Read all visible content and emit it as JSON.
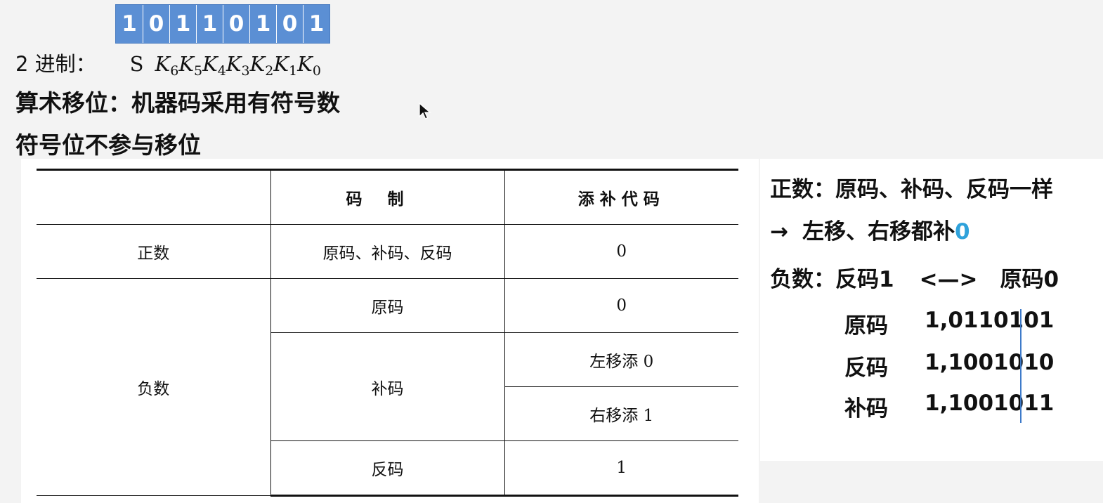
{
  "bits": [
    "1",
    "0",
    "1",
    "1",
    "0",
    "1",
    "0",
    "1"
  ],
  "base_line": {
    "label": "2 进制：",
    "sign": "S",
    "vars": [
      {
        "k": "K",
        "i": "6"
      },
      {
        "k": "K",
        "i": "5"
      },
      {
        "k": "K",
        "i": "4"
      },
      {
        "k": "K",
        "i": "3"
      },
      {
        "k": "K",
        "i": "2"
      },
      {
        "k": "K",
        "i": "1"
      },
      {
        "k": "K",
        "i": "0"
      }
    ]
  },
  "headings": {
    "h1": "算术移位：机器码采用有符号数",
    "h2": "符号位不参与移位"
  },
  "table": {
    "header": {
      "blank": "",
      "col1": "码制",
      "col2": "添补代码"
    },
    "positive": {
      "label": "正数",
      "code": "原码、补码、反码",
      "fill": "0"
    },
    "negative": {
      "label": "负数",
      "yuan": {
        "code": "原码",
        "fill": "0"
      },
      "bu": {
        "code": "补码",
        "fill_left": "左移添 0",
        "fill_right": "右移添 1"
      },
      "fan": {
        "code": "反码",
        "fill": "1"
      }
    }
  },
  "notes": {
    "line1": "正数：原码、补码、反码一样",
    "line2_arrow": "→",
    "line2_text": "左移、右移都补",
    "line2_value": "0",
    "line3_label": "负数：反码1",
    "line3_arrow": "<—>",
    "line3_tail": "原码0",
    "accent_color": "#2fa2db"
  },
  "codes": [
    {
      "label": "原码",
      "value": "1,0110101"
    },
    {
      "label": "反码",
      "value": "1,1001010"
    },
    {
      "label": "补码",
      "value": "1,1001011"
    }
  ],
  "colors": {
    "bit_bar": "#5b8fd4",
    "divider": "#3d7ac9"
  }
}
